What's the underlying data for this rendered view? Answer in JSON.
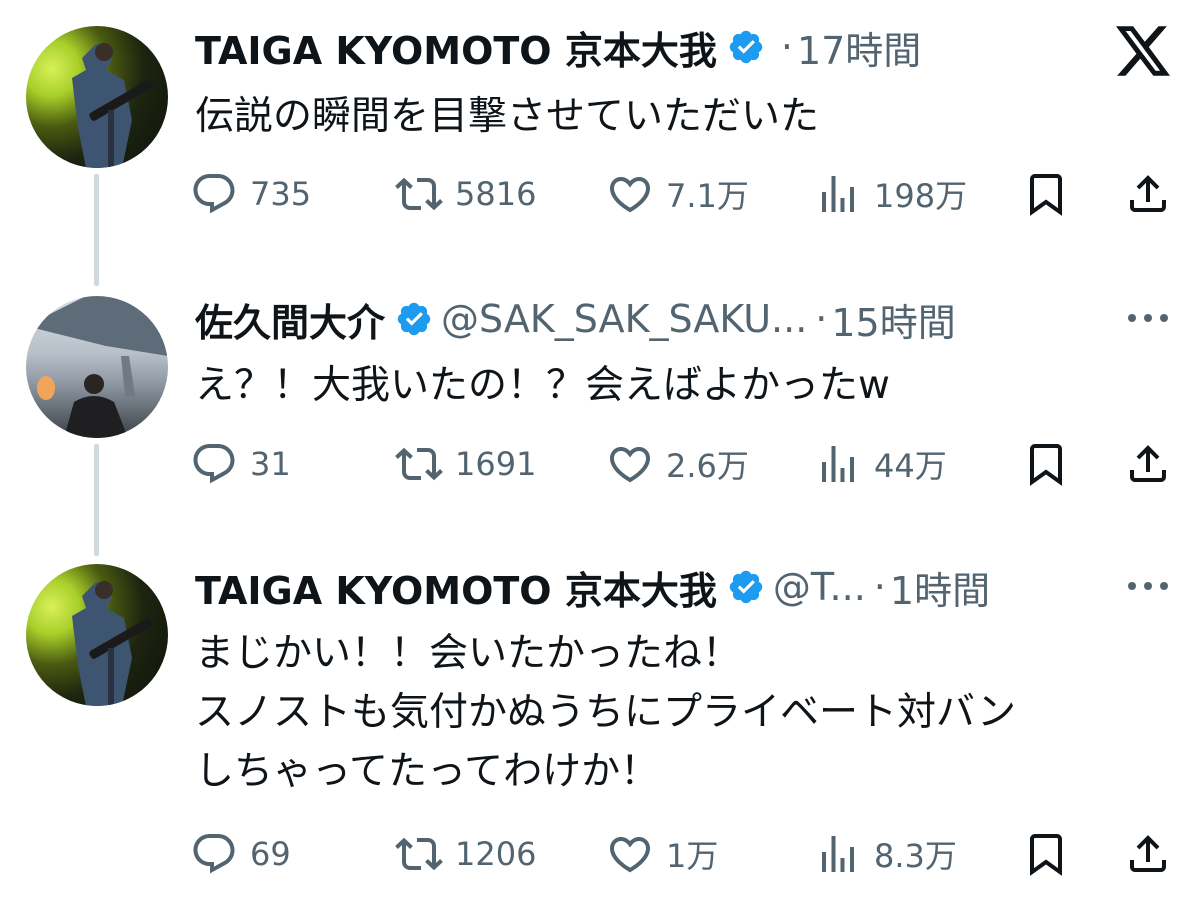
{
  "platform": {
    "logo_icon": "x-logo-icon"
  },
  "colors": {
    "verified": "#1d9bf0",
    "text": "#0f1419",
    "muted": "#536471",
    "thread_line": "#cfd9de"
  },
  "tweets": [
    {
      "name": "TAIGA KYOMOTO 京本大我",
      "verified": true,
      "handle": "",
      "dot": "·",
      "time": "17時間",
      "lines": [
        "伝説の瞬間を目撃させていただいた"
      ],
      "reply_count": "735",
      "retweet_count": "5816",
      "like_count": "7.1万",
      "view_count": "198万"
    },
    {
      "name": "佐久間大介",
      "verified": true,
      "handle": "@SAK_SAK_SAKU...",
      "dot": "·",
      "time": "15時間",
      "lines": [
        "え？！大我いたの！？会えばよかったw"
      ],
      "reply_count": "31",
      "retweet_count": "1691",
      "like_count": "2.6万",
      "view_count": "44万"
    },
    {
      "name": "TAIGA KYOMOTO 京本大我",
      "verified": true,
      "handle": "@T...",
      "dot": "·",
      "time": "1時間",
      "lines": [
        "まじかい！！会いたかったね！",
        "スノストも気付かぬうちにプライベート対バン",
        "しちゃってたってわけか！"
      ],
      "reply_count": "69",
      "retweet_count": "1206",
      "like_count": "1万",
      "view_count": "8.3万"
    }
  ]
}
